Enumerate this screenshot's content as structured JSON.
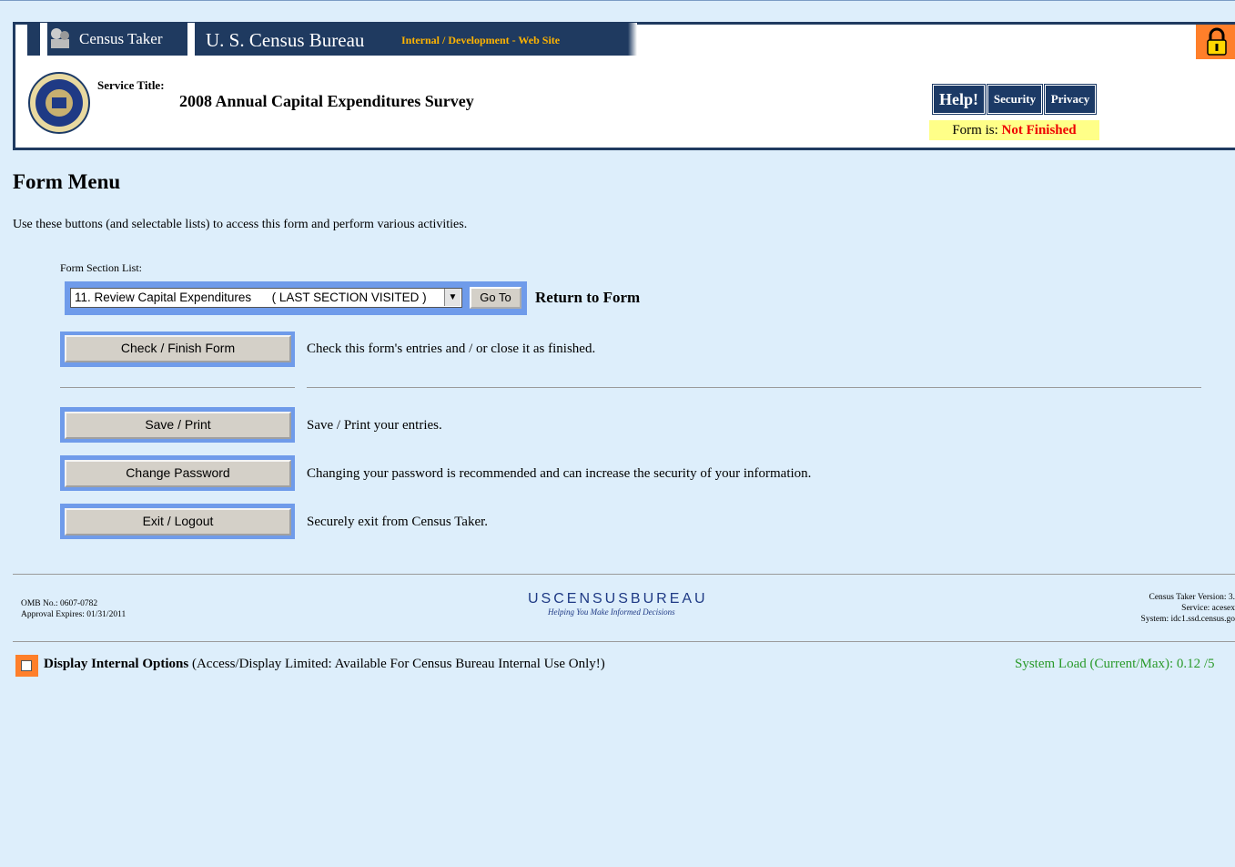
{
  "header": {
    "app_name": "Census Taker",
    "bureau_name": "U. S. Census Bureau",
    "site_type": "Internal / Development - Web Site",
    "service_label": "Service Title:",
    "service_title": "2008 Annual Capital Expenditures Survey",
    "help_label": "Help!",
    "security_label": "Security",
    "privacy_label": "Privacy",
    "status_prefix": "Form is:",
    "status_value": "Not Finished"
  },
  "main": {
    "title": "Form Menu",
    "intro": "Use these buttons (and selectable lists) to access this form and perform various activities.",
    "section_list_label": "Form Section List:",
    "section_selected": "11. Review Capital Expenditures      ( LAST SECTION VISITED )",
    "goto_label": "Go To",
    "return_label": "Return to Form",
    "actions": [
      {
        "label": "Check / Finish Form",
        "description": "Check this form's entries and / or close it as finished."
      },
      {
        "label": "Save / Print",
        "description": "Save / Print your entries."
      },
      {
        "label": "Change Password",
        "description": "Changing your password is recommended and can increase the security of your information."
      },
      {
        "label": "Exit / Logout",
        "description": "Securely exit from Census Taker."
      }
    ]
  },
  "footer": {
    "omb": "OMB No.: 0607-0782",
    "approval": "Approval Expires: 01/31/2011",
    "logo_text": "USCENSUSBUREAU",
    "tagline": "Helping You Make Informed Decisions",
    "version": "Census Taker Version: 3.",
    "service": "Service: acesex",
    "system": "System: idc1.ssd.census.go"
  },
  "internal": {
    "label_bold": "Display Internal Options",
    "label_rest": " (Access/Display Limited: Available For Census Bureau Internal Use Only!)",
    "system_load": "System Load (Current/Max): 0.12 /5"
  },
  "colors": {
    "background": "#ddeefb",
    "navy": "#1c3a66",
    "button_frame": "#6f9bea",
    "status_highlight": "#ffff88",
    "alert": "#ff7f2a"
  }
}
